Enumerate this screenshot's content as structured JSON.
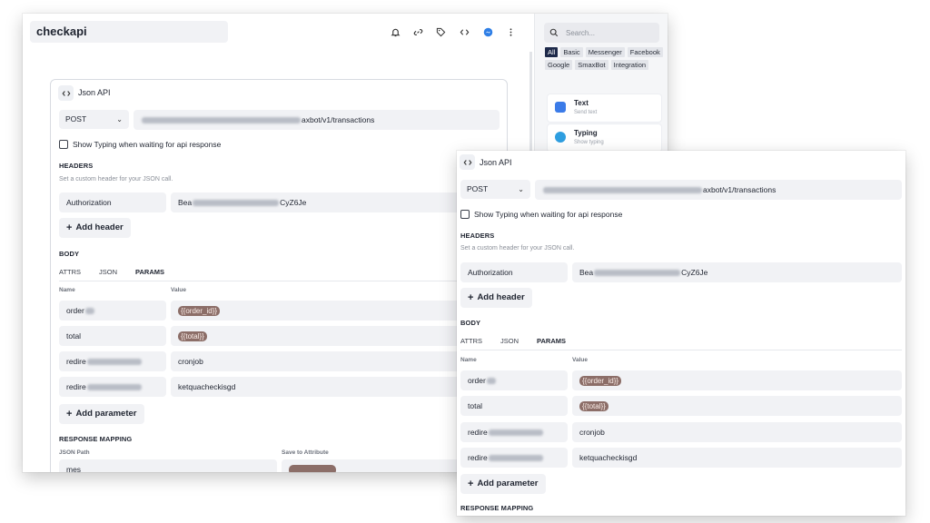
{
  "app": {
    "title": "checkapi"
  },
  "toolbar": {
    "icons": [
      "bell-icon",
      "link-icon",
      "tag-icon",
      "code-icon",
      "messenger-icon",
      "more-icon"
    ]
  },
  "sidebar": {
    "search_placeholder": "Search...",
    "filters": [
      "All",
      "Basic",
      "Messenger",
      "Facebook",
      "Google",
      "SmaxBot",
      "Integration"
    ],
    "active_filter": "All",
    "cards": [
      {
        "title": "Text",
        "subtitle": "Send text",
        "icon": "text-icon",
        "color": "#3b7be8"
      },
      {
        "title": "Typing",
        "subtitle": "Show typing",
        "icon": "typing-icon",
        "color": "#2e9ee0"
      }
    ]
  },
  "json_api": {
    "title": "Json API",
    "method": "POST",
    "url_suffix": "axbot/v1/transactions",
    "show_typing_label": "Show Typing when waiting for api response",
    "headers_title": "HEADERS",
    "headers_hint": "Set a custom header for your JSON call.",
    "header_name": "Authorization",
    "header_value_prefix": "Bea",
    "header_value_suffix": "CyZ6Je",
    "add_header_label": "Add header",
    "body_title": "BODY",
    "tabs": [
      "ATTRS",
      "JSON",
      "PARAMS"
    ],
    "active_tab": "PARAMS",
    "name_col": "Name",
    "value_col": "Value",
    "params": [
      {
        "name_prefix": "order",
        "value": "{{order_id}}",
        "is_tag": true
      },
      {
        "name_prefix": "total",
        "value": "{{total}}",
        "is_tag": true
      },
      {
        "name_prefix": "redire",
        "value": "cronjob",
        "is_tag": false
      },
      {
        "name_prefix": "redire",
        "value": "ketquacheckisgd",
        "is_tag": false
      }
    ],
    "add_parameter_label": "Add parameter",
    "response_mapping_title": "RESPONSE MAPPING",
    "json_path_col": "JSON Path",
    "save_attr_col": "Save to Attribute",
    "mapping_first_path": "mes"
  },
  "colors": {
    "tag_bg": "#8c6e68",
    "active_chip": "#1e2a4a",
    "field_bg": "#f1f2f5"
  }
}
